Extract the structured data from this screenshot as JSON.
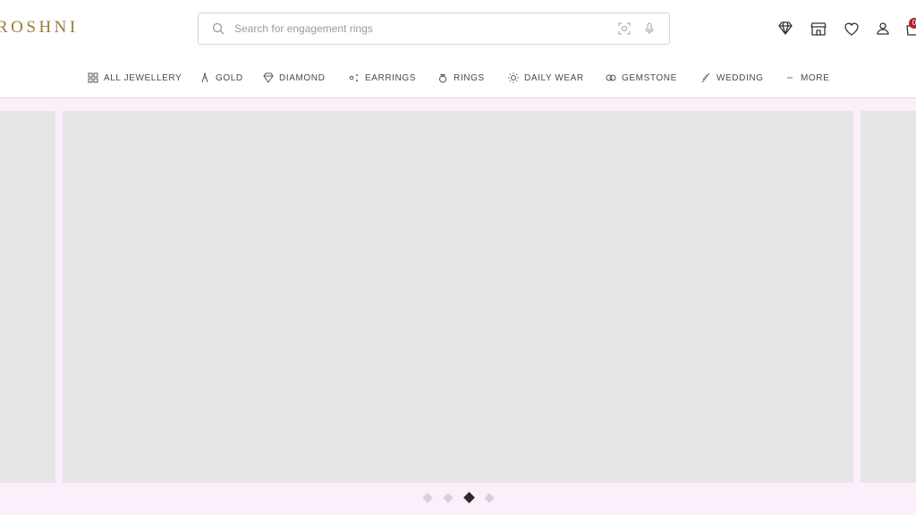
{
  "header": {
    "logo": "ROSHNI",
    "search": {
      "placeholder": "Search for engagement rings",
      "value": ""
    },
    "icons": [
      "diamond-icon",
      "store-icon",
      "wishlist-heart-icon",
      "account-icon",
      "cart-icon"
    ],
    "cart_badge": "0"
  },
  "nav": {
    "items": [
      {
        "label": "ALL JEWELLERY",
        "icon": "grid-icon"
      },
      {
        "label": "GOLD",
        "icon": "gold-icon"
      },
      {
        "label": "DIAMOND",
        "icon": "diamond-icon"
      },
      {
        "label": "EARRINGS",
        "icon": "earrings-icon"
      },
      {
        "label": "RINGS",
        "icon": "ring-icon"
      },
      {
        "label": "DAILY WEAR",
        "icon": "sun-icon"
      },
      {
        "label": "GEMSTONE",
        "icon": "gemstone-icon"
      },
      {
        "label": "WEDDING",
        "icon": "wedding-icon"
      },
      {
        "label": "MORE",
        "icon": "more-icon"
      }
    ]
  },
  "carousel": {
    "slide_count": 4,
    "active_index": 2
  },
  "colors": {
    "brand_gold": "#9a7a3a",
    "page_bg": "#fbeffb",
    "placeholder_slide": "#e6e6e6",
    "badge": "#b0242c"
  }
}
